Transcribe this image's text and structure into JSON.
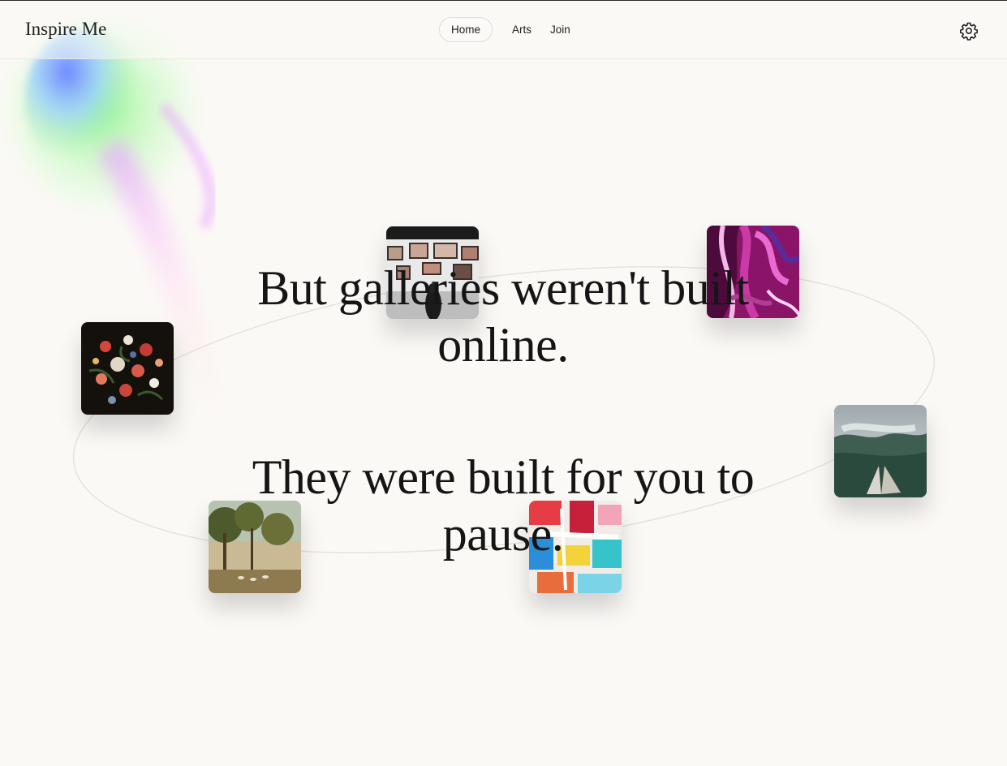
{
  "header": {
    "logo": "Inspire Me",
    "nav": [
      {
        "label": "Home",
        "active": true
      },
      {
        "label": "Arts",
        "active": false
      },
      {
        "label": "Join",
        "active": false
      }
    ],
    "settings_icon": "gear-icon"
  },
  "hero": {
    "line1": "But galleries weren't built online.",
    "line2": "They were built for you to pause."
  },
  "artworks": [
    {
      "name": "gallery-wall-photo"
    },
    {
      "name": "purple-fluid-art"
    },
    {
      "name": "flower-still-life"
    },
    {
      "name": "misty-forest-book"
    },
    {
      "name": "landscape-painting"
    },
    {
      "name": "colorful-abstract-paint"
    }
  ],
  "colors": {
    "background": "#fbf9f6",
    "text": "#151515",
    "orbit_line": "#e4e0da"
  }
}
